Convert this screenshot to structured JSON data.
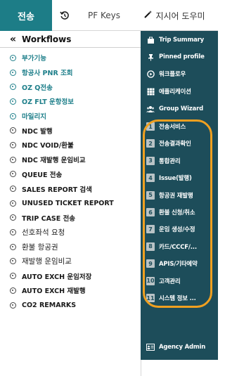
{
  "tabs": {
    "active": "전송",
    "history_icon": "history-icon",
    "pf_keys": "PF Keys",
    "help": "지시어 도우미"
  },
  "workflows": {
    "collapse": "«",
    "title": "Workflows",
    "items": [
      {
        "label": "부가기능",
        "style": "teal"
      },
      {
        "label": "항공사 PNR 조회",
        "style": "teal"
      },
      {
        "label": "OZ Q전송",
        "style": "teal"
      },
      {
        "label": "OZ FLT 운항정보",
        "style": "teal"
      },
      {
        "label": "마일리지",
        "style": "teal"
      },
      {
        "label": "NDC 발행",
        "style": "bold"
      },
      {
        "label": "NDC VOID/환불",
        "style": "bold"
      },
      {
        "label": "NDC 재발행 운임비교",
        "style": "bold"
      },
      {
        "label": "QUEUE 전송",
        "style": "bold"
      },
      {
        "label": "SALES REPORT 검색",
        "style": "bold"
      },
      {
        "label": "UNUSED TICKET REPORT",
        "style": "bold"
      },
      {
        "label": "TRIP CASE 전송",
        "style": "bold"
      },
      {
        "label": "선호좌석 요청",
        "style": "plain"
      },
      {
        "label": "환불 항공권",
        "style": "plain"
      },
      {
        "label": "재발행 운임비교",
        "style": "plain"
      },
      {
        "label": "AUTO EXCH 운임저장",
        "style": "bold"
      },
      {
        "label": "AUTO EXCH 재발행",
        "style": "bold"
      },
      {
        "label": "CO2 REMARKS",
        "style": "bold"
      }
    ]
  },
  "sidebar": {
    "top_items": [
      {
        "label": "Trip Summary",
        "icon": "briefcase-icon"
      },
      {
        "label": "Pinned profile",
        "icon": "pin-icon"
      },
      {
        "label": "워크플로우",
        "icon": "play-circle-icon"
      },
      {
        "label": "애플리케이션",
        "icon": "grid-icon"
      },
      {
        "label": "Group Wizard",
        "icon": "group-icon"
      }
    ],
    "numbered_items": [
      {
        "num": "1",
        "label": "전송서비스"
      },
      {
        "num": "2",
        "label": "전송결과확인"
      },
      {
        "num": "3",
        "label": "통합관리"
      },
      {
        "num": "4",
        "label": "Issue(발행)"
      },
      {
        "num": "5",
        "label": "항공권 재발행"
      },
      {
        "num": "6",
        "label": "환불 신청/취소"
      },
      {
        "num": "7",
        "label": "운임 생성/수정"
      },
      {
        "num": "8",
        "label": "카드/CCCF/..."
      },
      {
        "num": "9",
        "label": "APIS/기타예약"
      },
      {
        "num": "10",
        "label": "고객관리"
      },
      {
        "num": "11",
        "label": "시스템 정보 ..."
      }
    ],
    "bottom_item": {
      "label": "Agency Admin",
      "icon": "admin-icon"
    }
  },
  "colors": {
    "accent": "#1d7d87",
    "sidebar_bg": "#1d4d5a",
    "teal_text": "#1e7f8a",
    "highlight": "#f0a020"
  }
}
